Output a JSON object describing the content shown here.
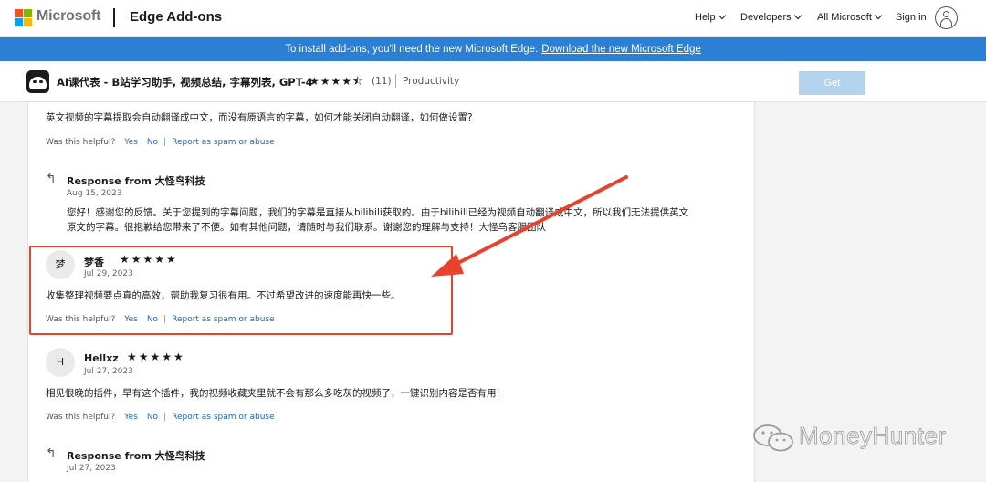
{
  "header": {
    "brand_name": "Microsoft",
    "site_title": "Edge Add-ons",
    "nav": [
      {
        "label": "Help"
      },
      {
        "label": "Developers"
      },
      {
        "label": "All Microsoft"
      }
    ],
    "sign_in": "Sign in"
  },
  "banner": {
    "text": "To install add-ons, you'll need the new Microsoft Edge.",
    "link": "Download the new Microsoft Edge"
  },
  "product": {
    "name": "AI课代表 - B站学习助手, 视频总结, 字幕列表, GPT-4",
    "rating": 4.5,
    "stars": "★★★★⯪",
    "rating_count": "(11)",
    "category": "Productivity",
    "get_label": "Get"
  },
  "helpful": {
    "question": "Was this helpful?",
    "yes": "Yes",
    "no": "No",
    "report": "Report as spam or abuse"
  },
  "reviews": [
    {
      "body": "英文视频的字幕提取会自动翻译成中文，而没有原语言的字幕，如何才能关闭自动翻译，如何做设置?"
    },
    {
      "response": {
        "title": "Response from 大怪鸟科技",
        "date": "Aug 15, 2023",
        "line1": "您好！感谢您的反馈。关于您提到的字幕问题，我们的字幕是直接从bilibili获取的。由于bilibili已经为视频自动翻译成中文，所以我们无法提供英文",
        "line2": "原文的字幕。很抱歉给您带来了不便。如有其他问题，请随时与我们联系。谢谢您的理解与支持！大怪鸟客服团队"
      }
    },
    {
      "avatar": "梦",
      "name": "梦香",
      "stars": "★★★★★",
      "rating": 5,
      "date": "Jul 29, 2023",
      "body": "收集整理视频要点真的高效，帮助我复习很有用。不过希望改进的速度能再快一些。"
    },
    {
      "avatar": "H",
      "name": "Hellxz",
      "stars": "★★★★★",
      "rating": 5,
      "date": "Jul 27, 2023",
      "body": "相见恨晚的插件，早有这个插件，我的视频收藏夹里就不会有那么多吃灰的视频了，一键识别内容是否有用!"
    },
    {
      "response": {
        "title": "Response from 大怪鸟科技",
        "date": "Jul 27, 2023"
      }
    }
  ],
  "watermark": {
    "text": "MoneyHunter"
  },
  "colors": {
    "banner": "#2b7fd4",
    "link": "#1a66c8",
    "highlight": "#e8412c",
    "get_button": "#b3d3ef"
  }
}
